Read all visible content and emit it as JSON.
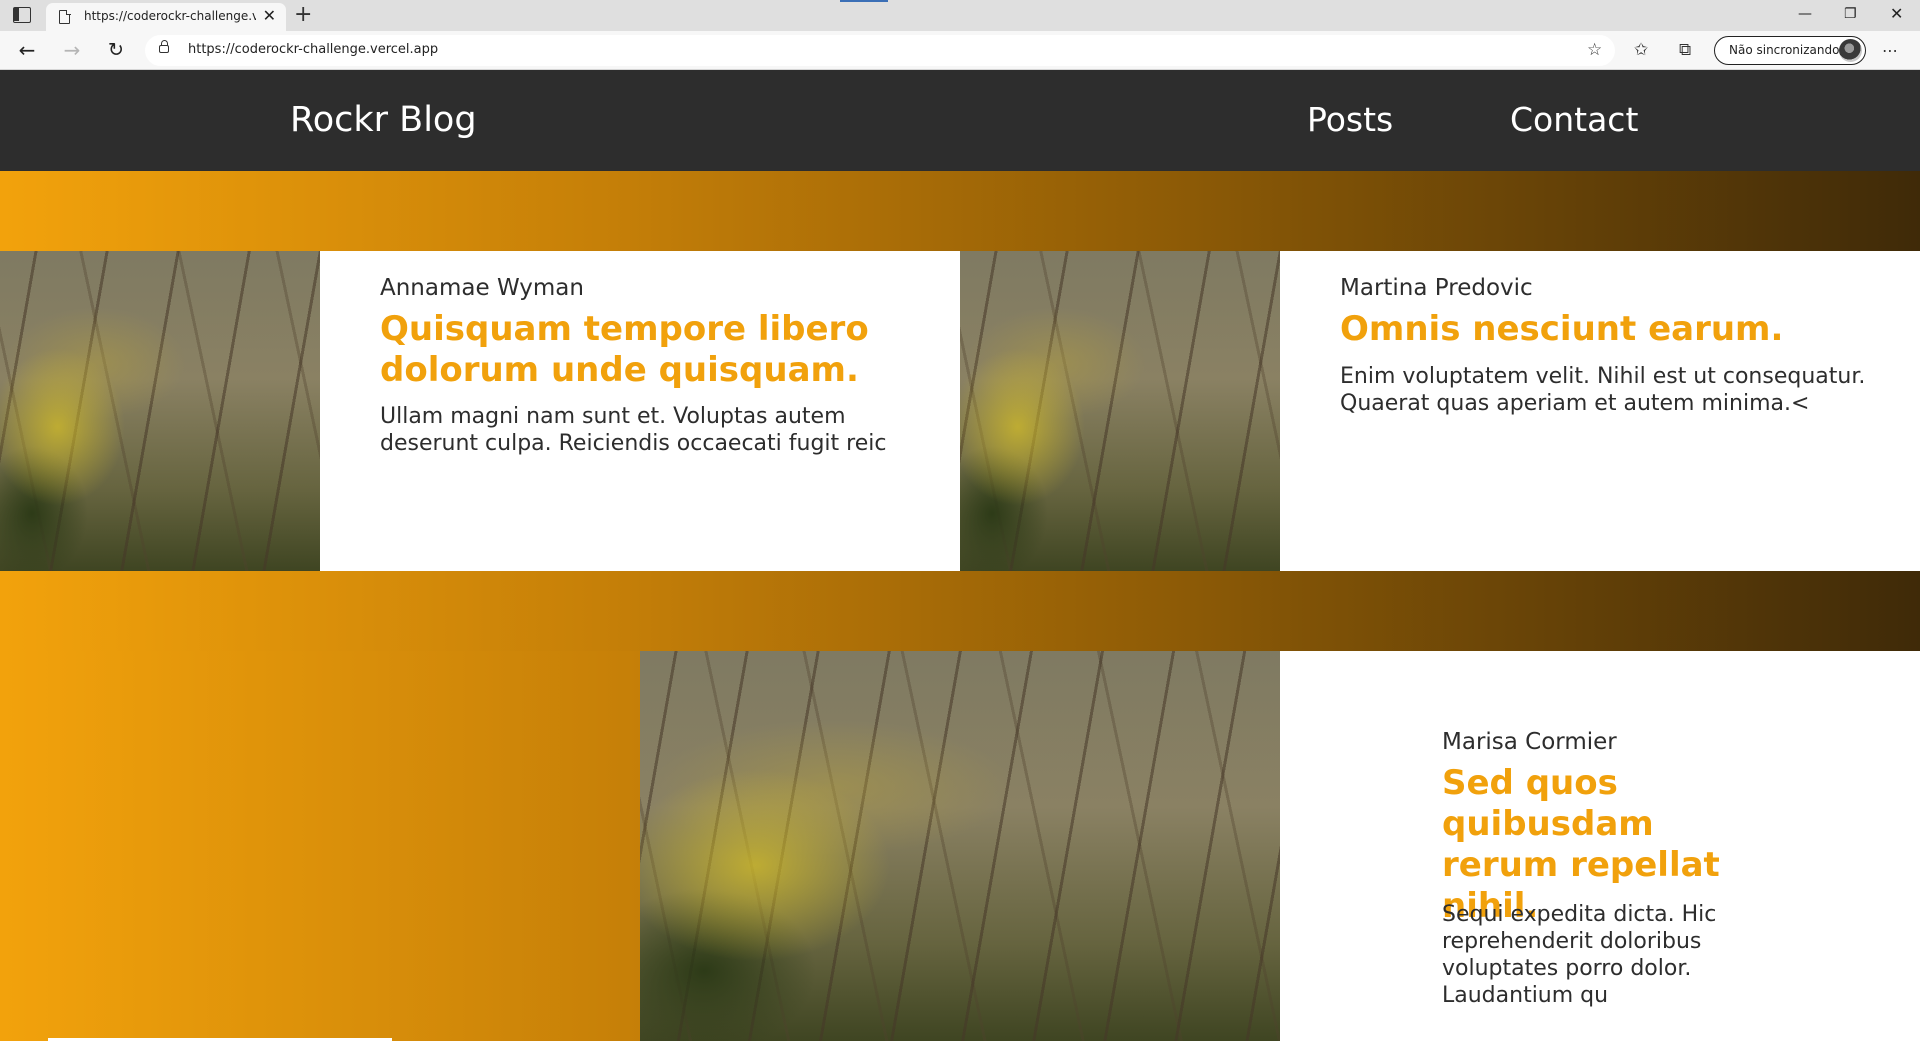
{
  "browser": {
    "tab_title": "https://coderockr-challenge.vercel.app",
    "new_tab_symbol": "+",
    "close_symbol": "✕",
    "url": "https://coderockr-challenge.vercel.app",
    "profile_label": "Não sincronizando",
    "window_controls": {
      "minimize": "—",
      "maximize": "❐",
      "close": "✕"
    }
  },
  "header": {
    "brand": "Rockr Blog",
    "nav": [
      {
        "label": "Posts"
      },
      {
        "label": "Contact"
      }
    ]
  },
  "posts": [
    {
      "author": "Annamae Wyman",
      "title": "Quisquam tempore libero dolorum unde quisquam.",
      "excerpt": "Ullam magni nam sunt et. Voluptas autem deserunt culpa. Reiciendis occaecati fugit reic"
    },
    {
      "author": "Martina Predovic",
      "title": "Omnis nesciunt earum.",
      "excerpt": "Enim voluptatem velit. Nihil est ut consequatur. Quaerat quas aperiam et autem minima.<"
    },
    {
      "author": "Marisa Cormier",
      "title": "Sed quos quibusdam rerum repellat nihil.",
      "excerpt": "Sequi expedita dicta. Hic reprehenderit doloribus voluptates porro dolor. Laudantium qu"
    }
  ],
  "colors": {
    "header_bg": "#2d2d2d",
    "accent": "#f1a10c",
    "gradient_start": "#f2a20c",
    "gradient_end": "#3f2a08"
  },
  "icons": [
    "tab-actions-icon",
    "page-icon",
    "back-arrow-icon",
    "forward-arrow-icon",
    "reload-icon",
    "lock-icon",
    "favorite-add-icon",
    "favorites-icon",
    "collections-icon",
    "more-icon"
  ]
}
